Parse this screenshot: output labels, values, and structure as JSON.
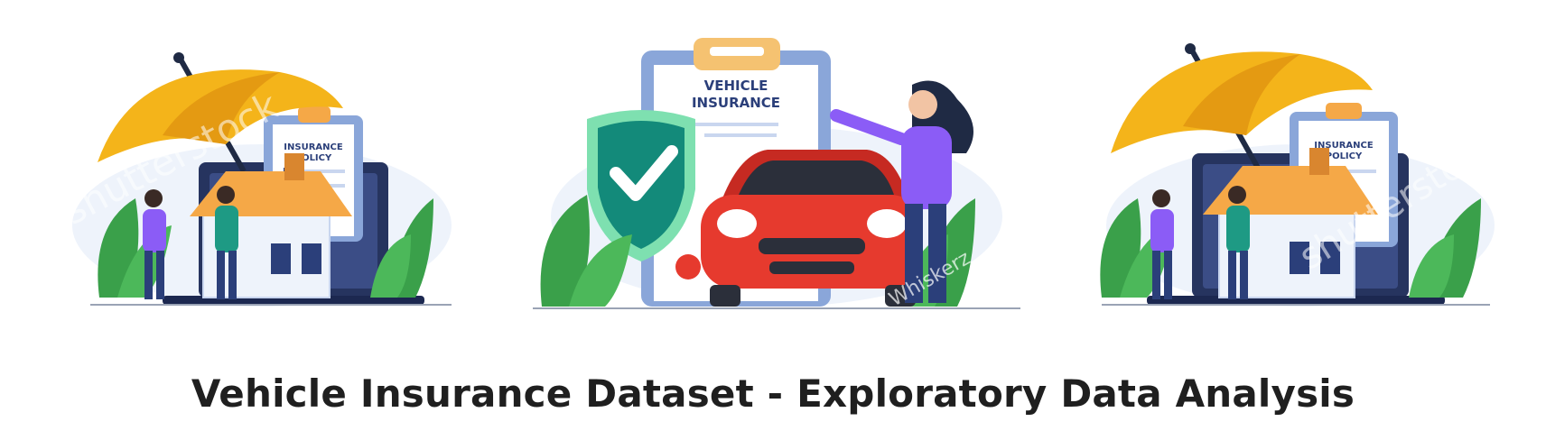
{
  "title": "Vehicle Insurance Dataset - Exploratory Data Analysis",
  "illustrations": [
    {
      "clipboard_line1": "INSURANCE",
      "clipboard_line2": "POLICY",
      "watermark": "shutterstock"
    },
    {
      "clipboard_line1": "VEHICLE",
      "clipboard_line2": "INSURANCE",
      "watermark": "Whiskerz"
    },
    {
      "clipboard_line1": "INSURANCE",
      "clipboard_line2": "POLICY",
      "watermark": "shutterstock"
    }
  ],
  "colors": {
    "umbrella": "#f4b41a",
    "umbrella_dark": "#e49a12",
    "house_roof": "#f5a847",
    "leaves": "#3aa04a",
    "shield": "#1e9a84",
    "car": "#e63a2e",
    "person_purple": "#8b5cf6",
    "person_navy": "#2b3f7a",
    "clipboard": "#8aa6d9",
    "laptop": "#26345f",
    "title": "#1f1f1f"
  }
}
